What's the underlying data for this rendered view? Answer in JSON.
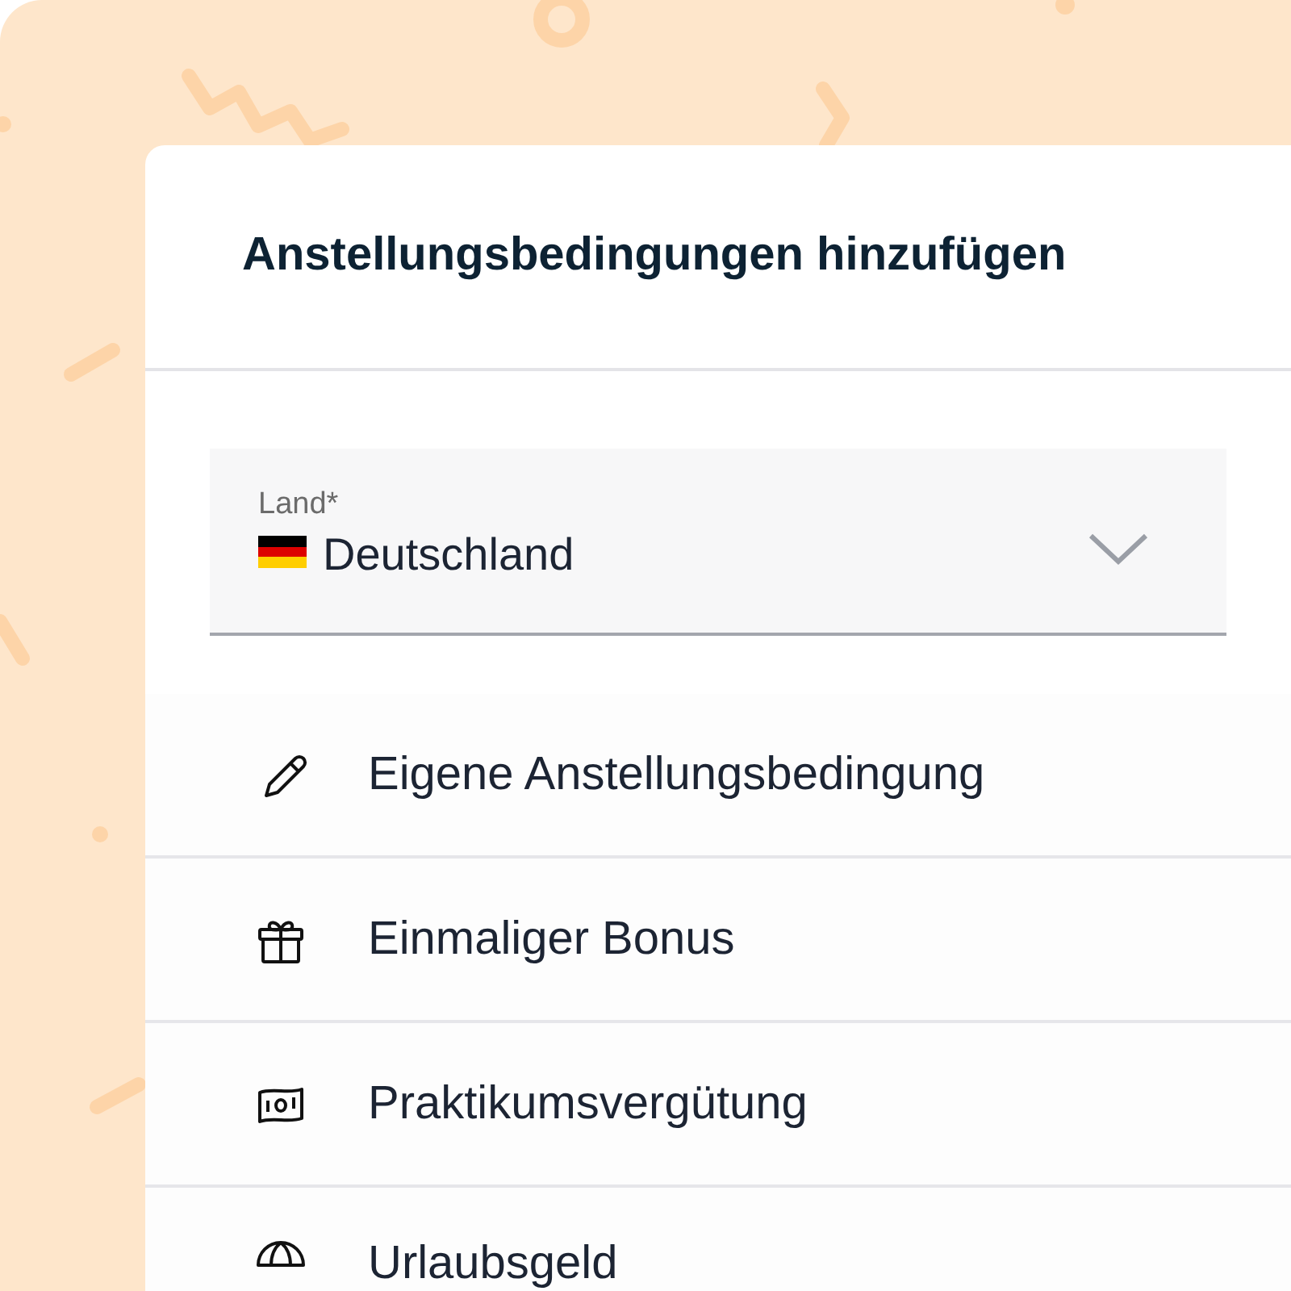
{
  "dialog": {
    "title": "Anstellungsbedingungen hinzufügen",
    "country_field": {
      "label": "Land*",
      "value": "Deutschland"
    },
    "options": [
      {
        "kind": "pencil",
        "label": "Eigene Anstellungsbedingung"
      },
      {
        "kind": "gift",
        "label": "Einmaliger Bonus"
      },
      {
        "kind": "money",
        "label": "Praktikumsvergütung"
      },
      {
        "kind": "umbrella",
        "label": "Urlaubsgeld"
      }
    ]
  }
}
